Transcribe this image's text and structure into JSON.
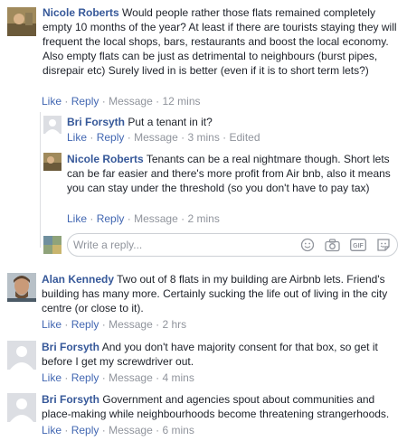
{
  "comments": [
    {
      "author": "Nicole Roberts",
      "text": "Would people rather those flats remained completely empty 10 months of the year? At least if there are tourists staying they will frequent the local shops, bars, restaurants and boost the local economy. Also empty flats can be just as detrimental to neighbours (burst pipes, disrepair etc) Surely lived in is better (even if it is to short term lets?)",
      "like": "Like",
      "reply": "Reply",
      "message": "Message",
      "time": "12 mins"
    },
    {
      "author": "Bri Forsyth",
      "text": "Put a tenant in it?",
      "like": "Like",
      "reply": "Reply",
      "message": "Message",
      "time": "3 mins",
      "edited": "Edited"
    },
    {
      "author": "Nicole Roberts",
      "text": "Tenants can be a real nightmare though. Short lets can be far easier and there's more profit from Air bnb, also it means you can stay under the threshold (so you don't have to pay tax)",
      "like": "Like",
      "reply": "Reply",
      "message": "Message",
      "time": "2 mins"
    },
    {
      "author": "Alan Kennedy",
      "text": "Two out of 8 flats in my building are Airbnb lets. Friend's building has many more. Certainly sucking the life out of living in the city centre (or close to it).",
      "like": "Like",
      "reply": "Reply",
      "message": "Message",
      "time": "2 hrs"
    },
    {
      "author": "Bri Forsyth",
      "text": "And you don't have majority consent for that box, so get it before I get my screwdriver out.",
      "like": "Like",
      "reply": "Reply",
      "message": "Message",
      "time": "4 mins"
    },
    {
      "author": "Bri Forsyth",
      "text": "Government and agencies spout about communities and place-making while neighbourhoods become threatening strangerhoods.",
      "like": "Like",
      "reply": "Reply",
      "message": "Message",
      "time": "6 mins"
    }
  ],
  "composer": {
    "placeholder": "Write a reply...",
    "icons": [
      "emoji-icon",
      "camera-icon",
      "gif-icon",
      "sticker-icon"
    ]
  },
  "colors": {
    "link": "#365899",
    "action": "#4267b2",
    "meta": "#90949c",
    "text": "#1d2129"
  }
}
